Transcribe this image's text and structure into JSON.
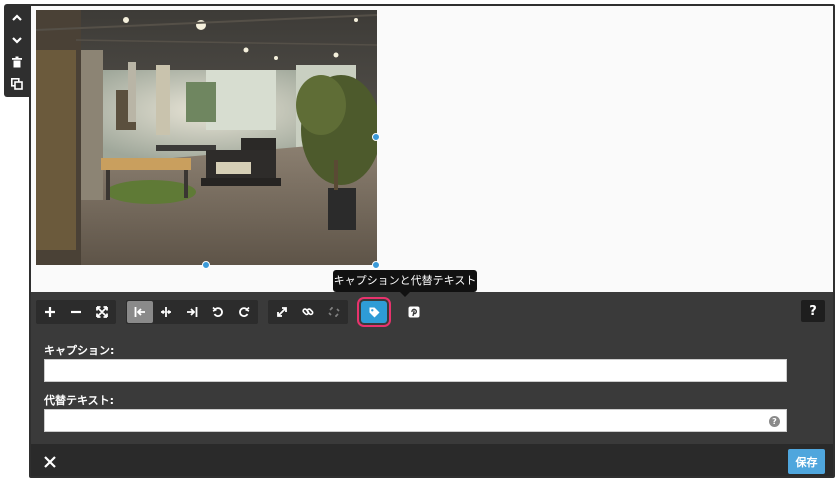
{
  "side_toolbar": {
    "icons": [
      "chevron-up-icon",
      "chevron-down-icon",
      "trash-icon",
      "duplicate-icon"
    ]
  },
  "image": {
    "description_icon": "photo"
  },
  "tooltip": {
    "text": "キャプションと代替テキスト"
  },
  "toolbar": {
    "groups": [
      [
        "plus-icon",
        "minus-icon",
        "fullscreen-icon"
      ],
      [
        "align-left-icon",
        "align-center-icon",
        "align-right-icon",
        "rotate-left-icon",
        "rotate-right-icon"
      ],
      [
        "resize-icon",
        "link-icon",
        "unlink-icon"
      ],
      [
        "tag-icon"
      ],
      [
        "pinterest-icon"
      ]
    ],
    "active": "align-left-icon",
    "selected": "tag-icon",
    "help_label": "?"
  },
  "form": {
    "caption_label": "キャプション:",
    "caption_value": "",
    "alt_label": "代替テキスト:",
    "alt_value": "",
    "hint_label": "?"
  },
  "footer": {
    "save_label": "保存"
  },
  "colors": {
    "accent": "#2e9cd6",
    "highlight": "#e8336d",
    "panel": "#3a3a3a",
    "save": "#4fa6dd"
  }
}
